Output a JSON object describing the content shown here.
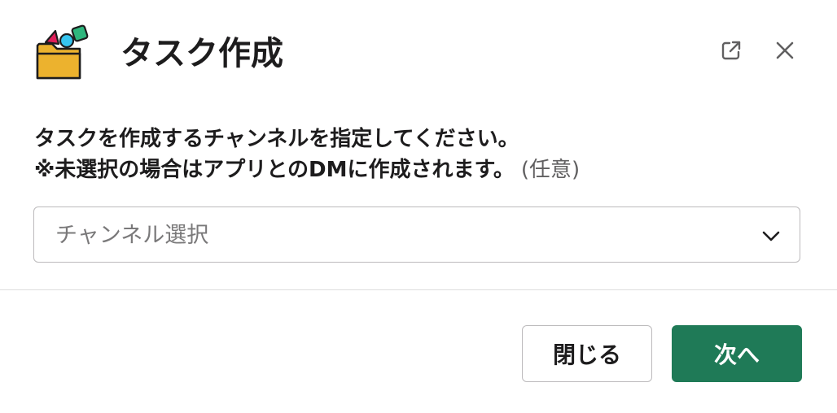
{
  "dialog": {
    "title": "タスク作成",
    "icons": {
      "app": "task-folder-shapes-icon",
      "popout": "external-link-icon",
      "close": "close-icon"
    }
  },
  "form": {
    "prompt_line1": "タスクを作成するチャンネルを指定してください。",
    "prompt_line2": "※未選択の場合はアプリとのDMに作成されます。",
    "optional_label": "(任意)",
    "channel_select": {
      "placeholder": "チャンネル選択",
      "selected_value": "",
      "icon": "chevron-down-icon"
    }
  },
  "footer": {
    "close_label": "閉じる",
    "next_label": "次へ"
  },
  "colors": {
    "primary": "#1f7a57",
    "text": "#1d1c1d",
    "muted": "#616061",
    "border": "#bcbabc",
    "folder": "#ecb22e",
    "triangle": "#e01e5a",
    "circle": "#36c5f0",
    "square": "#2eb67d"
  }
}
